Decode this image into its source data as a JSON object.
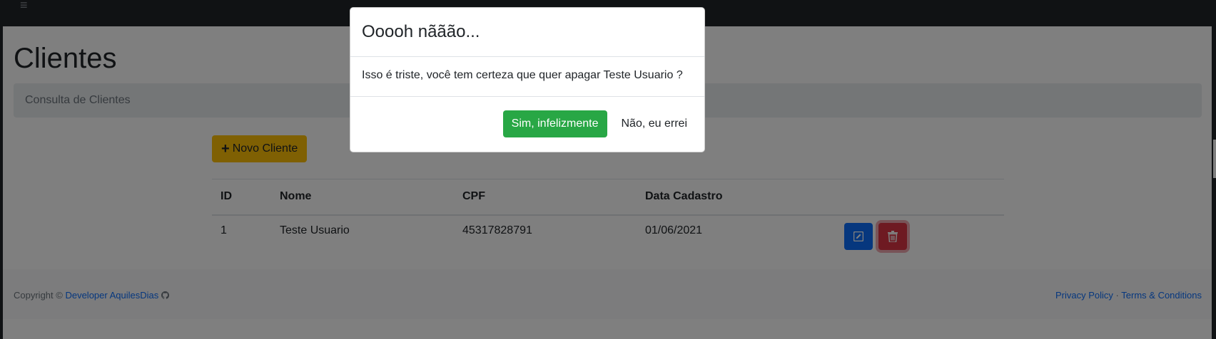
{
  "topbar": {
    "menu_icon": "hamburger-icon"
  },
  "page": {
    "title": "Clientes",
    "breadcrumb": "Consulta de Clientes"
  },
  "toolbar": {
    "new_button_label": "Novo Cliente",
    "new_button_icon": "plus-icon"
  },
  "table": {
    "headers": [
      "ID",
      "Nome",
      "CPF",
      "Data Cadastro",
      ""
    ],
    "rows": [
      {
        "id": "1",
        "nome": "Teste Usuario",
        "cpf": "45317828791",
        "data": "01/06/2021"
      }
    ]
  },
  "footer": {
    "copyright_prefix": "Copyright ©",
    "developer_link": "Developer AquilesDias",
    "github_icon": "github-icon",
    "privacy_link": "Privacy Policy",
    "separator": "·",
    "terms_link": "Terms & Conditions"
  },
  "modal": {
    "title": "Ooooh nããão...",
    "message": "Isso é triste, você tem certeza que quer apagar Teste Usuario ?",
    "confirm_label": "Sim, infelizmente",
    "cancel_label": "Não, eu errei"
  },
  "colors": {
    "topbar": "#212529",
    "warning": "#ffc107",
    "primary": "#0d6efd",
    "danger": "#dc3545",
    "success": "#28a745"
  }
}
